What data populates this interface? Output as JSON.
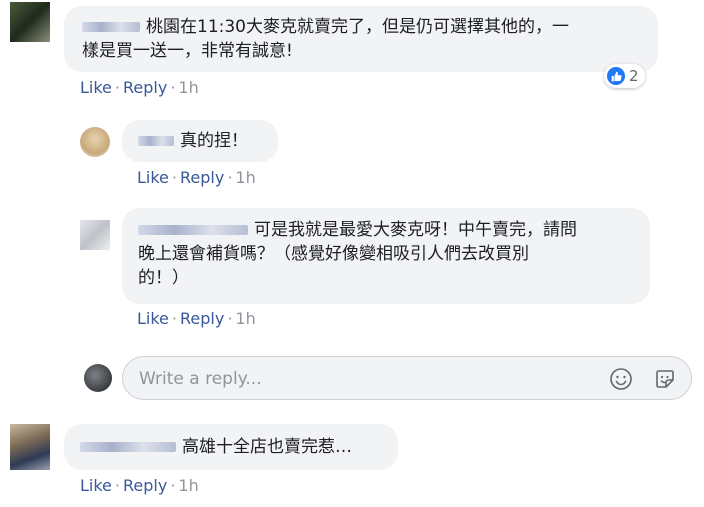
{
  "comments": [
    {
      "text": "桃園在11:30大麥克就賣完了，但是仍可選擇其他的，一樣是買一送一，非常有誠意!",
      "line1": "桃園在11:30大麥克就賣完了，但是仍可選擇其他的，一",
      "line2": "樣是買一送一，非常有誠意!",
      "like": "Like",
      "reply": "Reply",
      "sep": "·",
      "time": "1h",
      "reaction_count": "2"
    },
    {
      "text": "真的捏！",
      "like": "Like",
      "reply": "Reply",
      "sep": "·",
      "time": "1h"
    },
    {
      "text": "可是我就是最愛大麥克呀！中午賣完，請問晚上還會補貨嗎？（感覺好像變相吸引人們去改買別的！）",
      "line1": "可是我就是最愛大麥克呀！中午賣完，請問",
      "line2": "晚上還會補貨嗎？（感覺好像變相吸引人們去改買別",
      "line3": "的！）",
      "like": "Like",
      "reply": "Reply",
      "sep": "·",
      "time": "1h"
    },
    {
      "text": "高雄十全店也賣完惹…",
      "like": "Like",
      "reply": "Reply",
      "sep": "·",
      "time": "1h"
    }
  ],
  "reply_input": {
    "placeholder": "Write a reply..."
  },
  "icons": {
    "reaction": "thumbs-up-icon",
    "emoji": "smiley-icon",
    "sticker": "sticker-icon"
  },
  "colors": {
    "link": "#385898",
    "meta": "#90949c",
    "bubble": "#f2f3f5",
    "like_blue": "#2078f4"
  }
}
